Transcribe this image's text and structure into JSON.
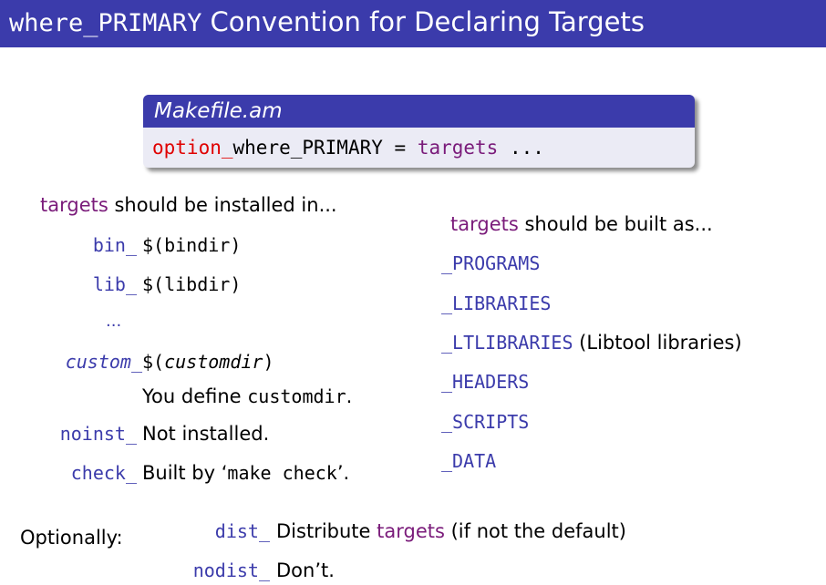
{
  "title": {
    "prefix": "where_PRIMARY",
    "rest": " Convention for Declaring Targets"
  },
  "code": {
    "filename": "Makefile.am",
    "option": "option_",
    "where_primary": "where_PRIMARY",
    "equals": " = ",
    "targets": "targets",
    "ellipsis": " ..."
  },
  "install": {
    "heading_targets": "targets",
    "heading_rest": " should be installed in...",
    "bin_key": "bin_",
    "bin_val": "$(bindir)",
    "lib_key": "lib_",
    "lib_val": "$(libdir)",
    "dots": "...",
    "custom_key": "custom_",
    "custom_val_open": "$(",
    "custom_val_var": "customdir",
    "custom_val_close": ")",
    "custom_note_pre": "You define ",
    "custom_note_code": "customdir",
    "custom_note_post": ".",
    "noinst_key": "noinst_",
    "noinst_val": "Not installed.",
    "check_key": "check_",
    "check_val_pre": "Built by ‘",
    "check_val_code": "make check",
    "check_val_post": "’."
  },
  "built": {
    "heading_targets": "targets",
    "heading_rest": " should be built as...",
    "items": [
      "_PROGRAMS",
      "_LIBRARIES",
      "_LTLIBRARIES",
      "_HEADERS",
      "_SCRIPTS",
      "_DATA"
    ],
    "ltlib_note": " (Libtool libraries)"
  },
  "optional": {
    "label": "Optionally:",
    "dist_key": "dist_",
    "dist_pre": "Distribute ",
    "dist_targets": "targets",
    "dist_post": " (if not the default)",
    "nodist_key": "nodist_",
    "nodist_val": "Don’t."
  }
}
